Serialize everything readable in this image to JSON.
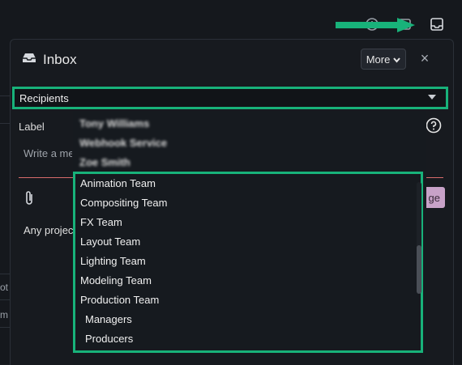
{
  "inbox": {
    "title": "Inbox",
    "more_label": "More",
    "close_glyph": "×"
  },
  "recipients": {
    "label": "Recipients"
  },
  "form": {
    "label_text": "Label",
    "message_placeholder": "Write a me",
    "send_label": "ge",
    "project_text": "Any project"
  },
  "dropdown": {
    "blurred_items": [
      "Tony Williams",
      "Webhook Service",
      "Zoe Smith"
    ],
    "teams": [
      {
        "label": "Animation Team",
        "indent": false
      },
      {
        "label": "Compositing Team",
        "indent": false
      },
      {
        "label": "FX Team",
        "indent": false
      },
      {
        "label": "Layout Team",
        "indent": false
      },
      {
        "label": "Lighting Team",
        "indent": false
      },
      {
        "label": "Modeling Team",
        "indent": false
      },
      {
        "label": "Production Team",
        "indent": false
      },
      {
        "label": "Managers",
        "indent": true
      },
      {
        "label": "Producers",
        "indent": true
      }
    ]
  },
  "background": {
    "left_texts": [
      "ot",
      "m"
    ]
  },
  "colors": {
    "highlight": "#18b27a",
    "send_button": "#c8a2c8",
    "input_line": "#d96b6b"
  },
  "icons": [
    "clock-icon",
    "filter-icon",
    "inbox-tray-icon",
    "help-circle-icon",
    "paperclip-icon",
    "chevron-down-icon",
    "close-icon",
    "arrow-right-icon"
  ]
}
